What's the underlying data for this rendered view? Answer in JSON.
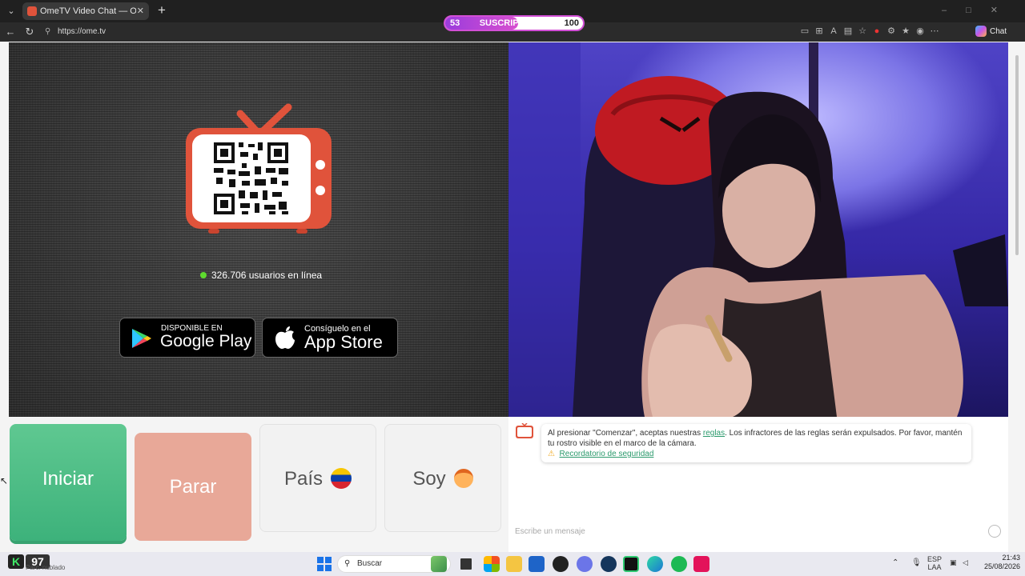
{
  "browser": {
    "tab_title": "OmeTV Video Chat — Omeg",
    "tab_close": "✕",
    "url": "https://ome.tv",
    "copilot_label": "Chat"
  },
  "overlay": {
    "left_value": "53",
    "label": "SUSCRIPTORES",
    "right_value": "100",
    "progress_fraction": 0.53
  },
  "ometv": {
    "online_text": "326.706 usuarios en línea",
    "google_play_small": "DISPONIBLE EN",
    "google_play_large": "Google Play",
    "app_store_small": "Consíguelo en el",
    "app_store_large": "App Store",
    "buttons": {
      "start": "Iniciar",
      "stop": "Parar",
      "country": "País",
      "gender": "Soy"
    },
    "chat": {
      "sys_prefix": "Al presionar \"Comenzar\", aceptas nuestras ",
      "sys_link": "reglas",
      "sys_suffix": ". Los infractores de las reglas serán expulsados. Por favor, mantén tu rostro visible en el marco de la cámara.",
      "safety_link": "Recordatorio de seguridad",
      "input_placeholder": "Escribe un mensaje"
    }
  },
  "taskbar": {
    "weather_value": "97",
    "weather_text": "Parc. nublado",
    "search_placeholder": "Buscar",
    "lang_top": "ESP",
    "lang_bottom": "LAA",
    "time": "21:43",
    "date": "25/08/2026"
  },
  "colors": {
    "start_button": "#4dbd86",
    "stop_button": "#e8a898",
    "tv_orange": "#e0533b",
    "online_dot": "#5edb2e",
    "overlay_border": "#d24fd6"
  }
}
